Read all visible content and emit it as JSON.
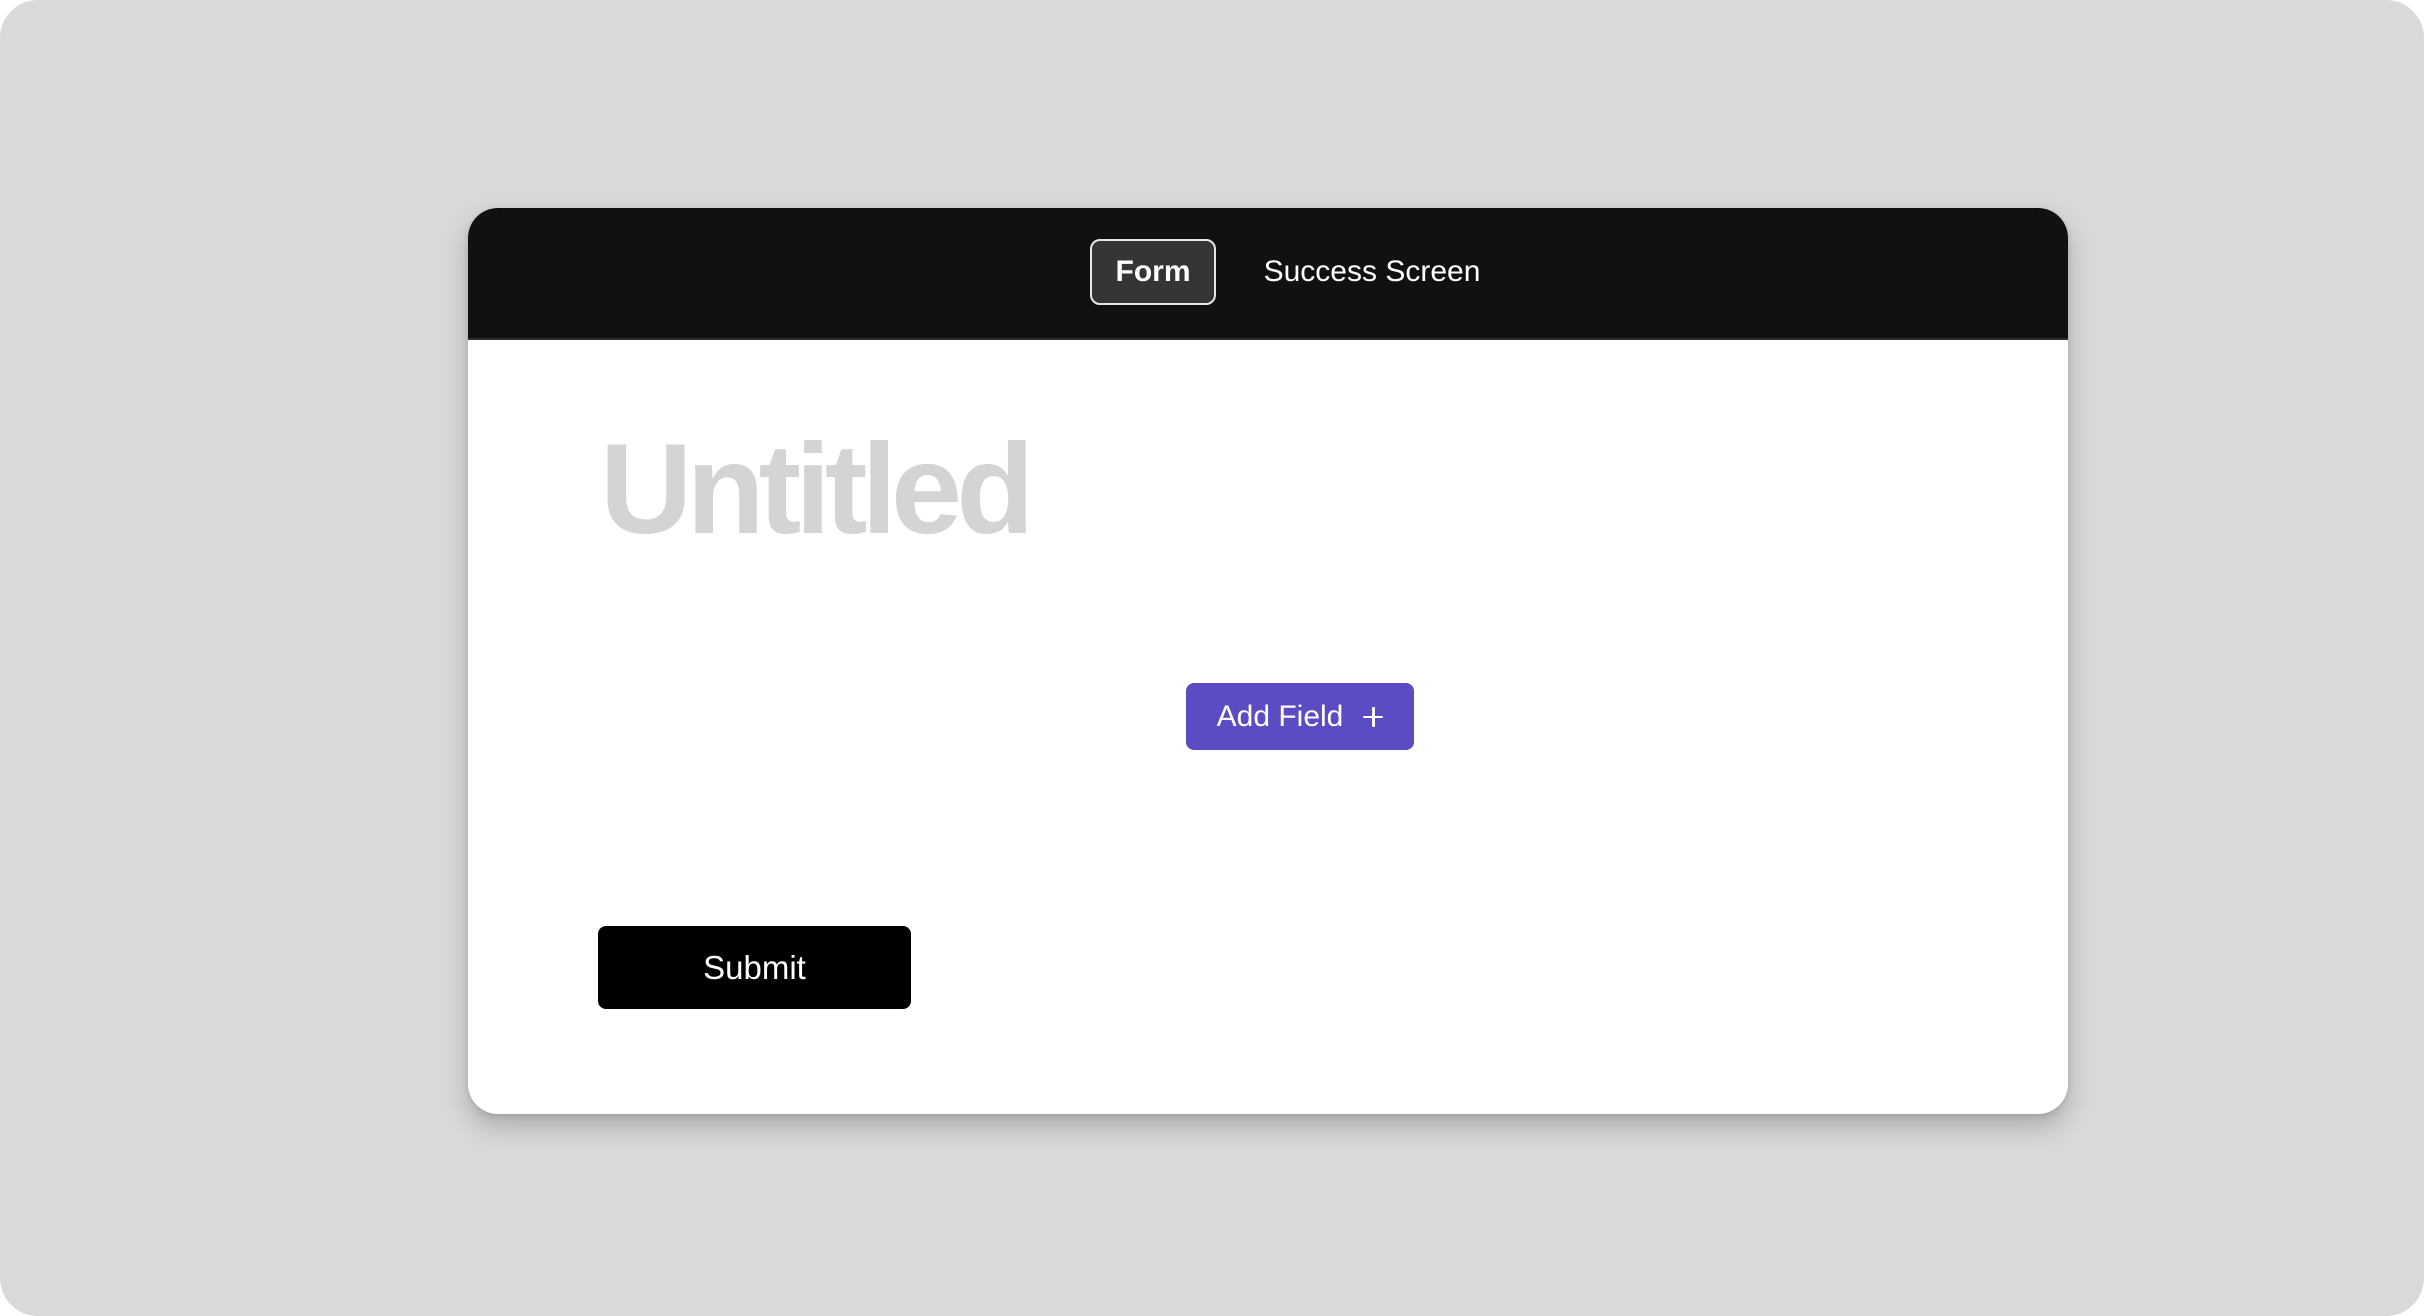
{
  "tabs": {
    "form_label": "Form",
    "success_label": "Success Screen",
    "active": "Form"
  },
  "form": {
    "title_placeholder": "Untitled",
    "add_field_label": "Add Field",
    "add_field_icon": "plus-icon",
    "submit_label": "Submit"
  },
  "colors": {
    "page_background": "#d9d9d9",
    "topbar_background": "#111111",
    "active_tab_background": "#353535",
    "add_field_background": "#5b4cc4",
    "submit_background": "#000000",
    "title_placeholder": "#d4d4d4"
  }
}
